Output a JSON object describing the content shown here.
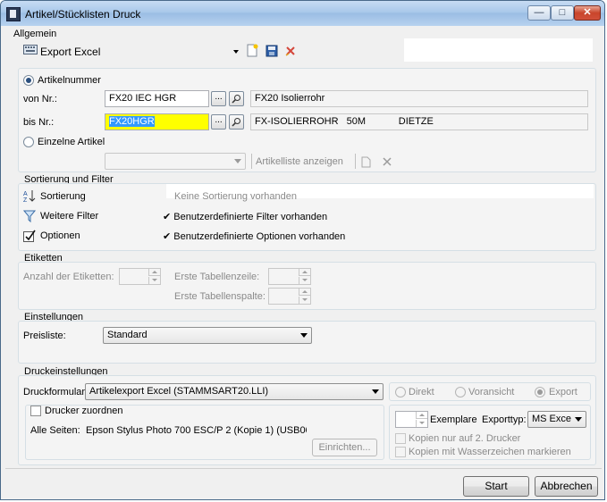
{
  "window": {
    "title": "Artikel/Stücklisten Druck"
  },
  "allgemein": {
    "label": "Allgemein",
    "profile": "Export Excel"
  },
  "selection": {
    "artikelnummer_label": "Artikelnummer",
    "von_label": "von Nr.:",
    "von_value": "FX20 IEC HGR",
    "von_desc": "FX20 Isolierrohr",
    "bis_label": "bis Nr.:",
    "bis_value": "FX20HGR",
    "bis_desc": "FX-ISOLIERROHR   50M            DIETZE",
    "browse_label": "...",
    "einzelne_label": "Einzelne Artikel",
    "artikelliste_label": "Artikelliste anzeigen"
  },
  "sortierung": {
    "label": "Sortierung und Filter",
    "sortierung_label": "Sortierung",
    "sortierung_status": "Keine Sortierung vorhanden",
    "filter_label": "Weitere Filter",
    "filter_status": "✔ Benutzerdefinierte Filter vorhanden",
    "optionen_label": "Optionen",
    "optionen_status": "✔ Benutzerdefinierte Optionen vorhanden"
  },
  "etiketten": {
    "label": "Etiketten",
    "anzahl_label": "Anzahl der Etiketten:",
    "zeile_label": "Erste Tabellenzeile:",
    "spalte_label": "Erste Tabellenspalte:"
  },
  "einstellungen": {
    "label": "Einstellungen",
    "preisliste_label": "Preisliste:",
    "preisliste_value": "Standard"
  },
  "druck": {
    "label": "Druckeinstellungen",
    "formular_label": "Druckformular:",
    "formular_value": "Artikelexport Excel (STAMMSART20.LLI)",
    "direkt_label": "Direkt",
    "voransicht_label": "Voransicht",
    "export_label": "Export",
    "drucker_zuordnen_label": "Drucker zuordnen",
    "alle_seiten_label": "Alle Seiten:",
    "alle_seiten_value": "Epson Stylus Photo 700 ESC/P 2 (Kopie 1) (USB00",
    "einrichten_label": "Einrichten...",
    "exemplare_label": "Exemplare",
    "exporttyp_label": "Exporttyp:",
    "exporttyp_value": "MS Exce",
    "kopien_label": "Kopien nur auf 2. Drucker",
    "wasserzeichen_label": "Kopien mit Wasserzeichen markieren"
  },
  "footer": {
    "start_label": "Start",
    "abbrechen_label": "Abbrechen"
  },
  "colors": {
    "highlight_field": "#ffff00",
    "selection": "#3399ff"
  }
}
